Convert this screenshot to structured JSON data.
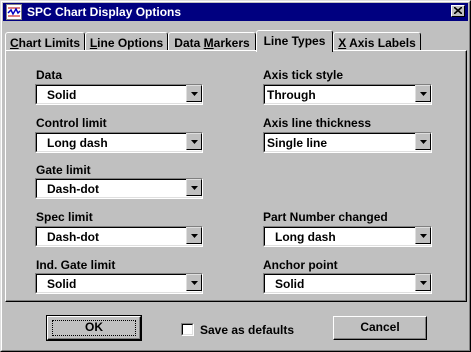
{
  "window": {
    "title": "SPC Chart Display Options"
  },
  "icons": {
    "app": "spc-chart-app-icon",
    "close": "close-icon",
    "dropdown": "chevron-down-icon"
  },
  "tabs": [
    {
      "label_pre": "",
      "accel": "C",
      "label_post": "hart Limits",
      "active": false
    },
    {
      "label_pre": "",
      "accel": "L",
      "label_post": "ine Options",
      "active": false
    },
    {
      "label_pre": "Data ",
      "accel": "M",
      "label_post": "arkers",
      "active": false
    },
    {
      "label_pre": "Line Types",
      "accel": "",
      "label_post": "",
      "active": true
    },
    {
      "label_pre": "",
      "accel": "X",
      "label_post": " Axis Labels",
      "active": false
    }
  ],
  "left_fields": [
    {
      "label": "Data",
      "value": "Solid"
    },
    {
      "label": "Control limit",
      "value": "Long dash"
    },
    {
      "label": "Gate limit",
      "value": "Dash-dot"
    },
    {
      "label": "Spec limit",
      "value": "Dash-dot"
    },
    {
      "label": "Ind. Gate limit",
      "value": "Solid"
    }
  ],
  "right_fields": [
    {
      "label": "Axis tick style",
      "value": "Through"
    },
    {
      "label": "Axis line thickness",
      "value": "Single line"
    },
    {
      "label": "Part Number changed",
      "value": "Long dash"
    },
    {
      "label": "Anchor point",
      "value": "Solid"
    }
  ],
  "buttons": {
    "ok": "OK",
    "cancel": "Cancel"
  },
  "save_defaults": {
    "label": "Save as defaults",
    "checked": false
  },
  "colors": {
    "titlebar": "#000080",
    "face": "#c0c0c0"
  }
}
